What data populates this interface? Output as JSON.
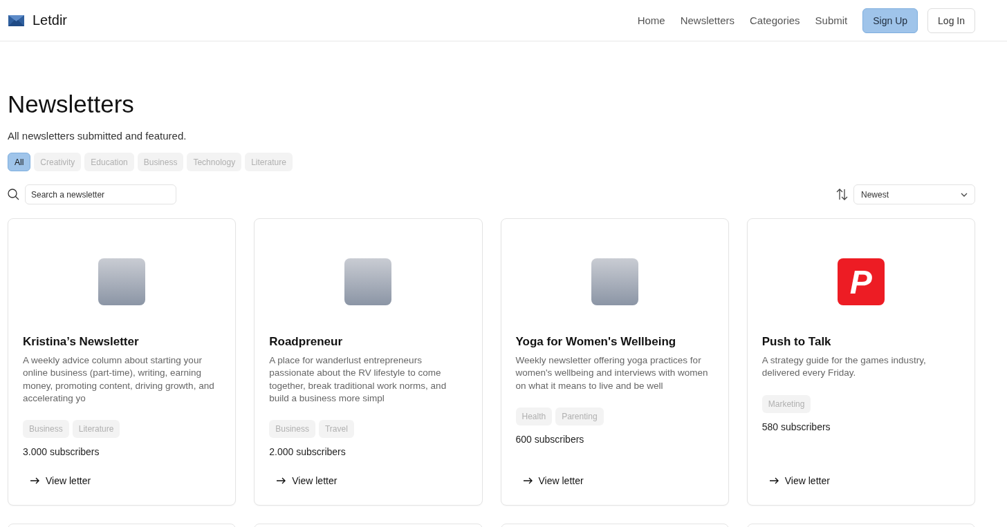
{
  "header": {
    "logo_text": "Letdir",
    "nav": [
      {
        "label": "Home"
      },
      {
        "label": "Newsletters"
      },
      {
        "label": "Categories"
      },
      {
        "label": "Submit"
      }
    ],
    "buttons": [
      {
        "label": "Sign Up",
        "kind": "primary"
      },
      {
        "label": "Log In",
        "kind": "secondary"
      }
    ]
  },
  "page": {
    "title": "Newsletters",
    "subtitle": "All newsletters submitted and featured."
  },
  "filters": [
    {
      "label": "All",
      "selected": true
    },
    {
      "label": "Creativity",
      "selected": false
    },
    {
      "label": "Education",
      "selected": false
    },
    {
      "label": "Business",
      "selected": false
    },
    {
      "label": "Technology",
      "selected": false
    },
    {
      "label": "Literature",
      "selected": false
    }
  ],
  "search": {
    "placeholder": "Search a newsletter"
  },
  "sort": {
    "value": "Newest"
  },
  "cards": [
    {
      "thumbnail": {
        "kind": "photo"
      },
      "title": "Kristina’s Newsletter",
      "description": "A weekly advice column about starting your online business (part-time), writing, earning money, promoting content, driving growth, and accelerating yo",
      "tags": [
        "Business",
        "Literature"
      ],
      "subscribers": "3.000 subscribers",
      "link": "View letter"
    },
    {
      "thumbnail": {
        "kind": "photo"
      },
      "title": "Roadpreneur",
      "description": "A place for wanderlust entrepreneurs passionate about the RV lifestyle to come together, break traditional work norms, and build a business more simpl",
      "tags": [
        "Business",
        "Travel"
      ],
      "subscribers": "2.000 subscribers",
      "link": "View letter"
    },
    {
      "thumbnail": {
        "kind": "photo"
      },
      "title": "Yoga for Women's Wellbeing",
      "description": "Weekly newsletter offering yoga practices for women's wellbeing and  interviews with women on what it means to live and be well",
      "tags": [
        "Health",
        "Parenting"
      ],
      "subscribers": "600 subscribers",
      "link": "View letter"
    },
    {
      "thumbnail": {
        "kind": "logo",
        "text": "P"
      },
      "title": "Push to Talk",
      "description": "A strategy guide for the games industry, delivered every Friday.",
      "tags": [
        "Marketing"
      ],
      "subscribers": "580 subscribers",
      "link": "View letter"
    }
  ]
}
